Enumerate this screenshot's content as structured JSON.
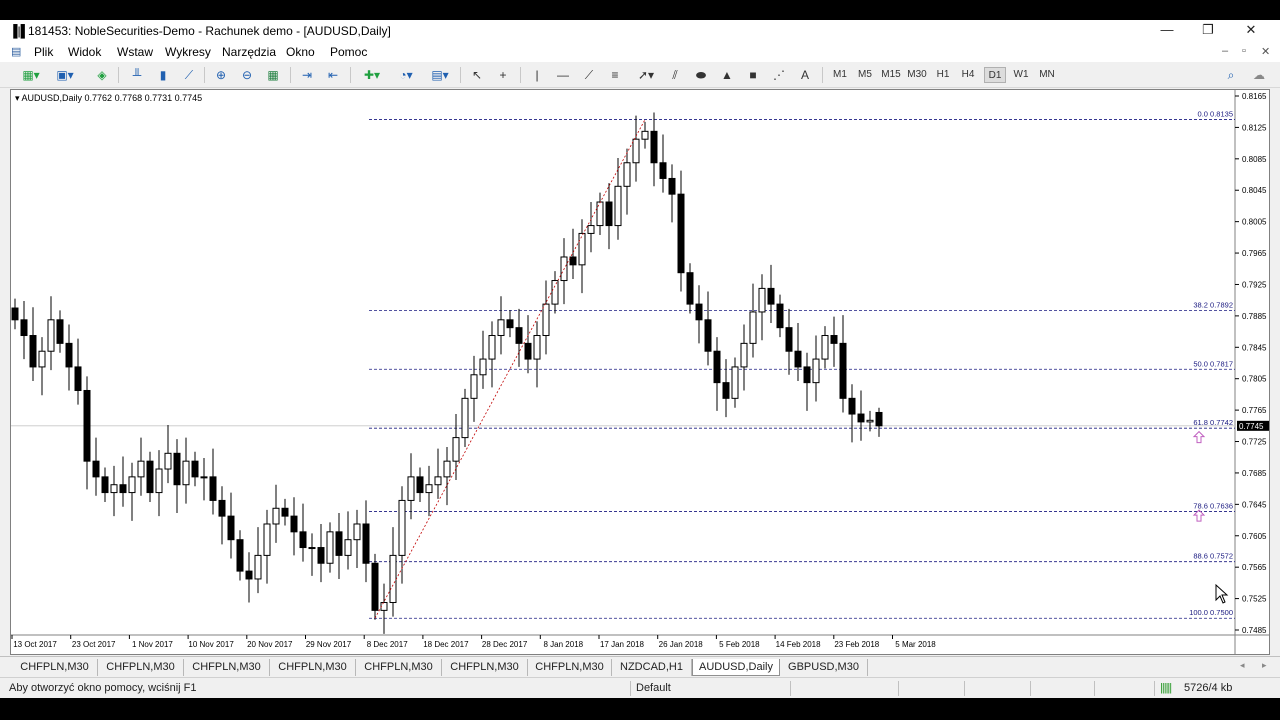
{
  "window": {
    "title": "181453: NobleSecurities-Demo - Rachunek demo - [AUDUSD,Daily]",
    "controls": {
      "minimize": "—",
      "restore": "❐",
      "close": "✕"
    }
  },
  "menu": {
    "items": [
      "Plik",
      "Widok",
      "Wstaw",
      "Wykresy",
      "Narzędzia",
      "Okno",
      "Pomoc"
    ],
    "mdi_controls": {
      "minimize": "–",
      "restore": "▫",
      "close": "✕"
    }
  },
  "toolbar": {
    "timeframes": [
      "M1",
      "M5",
      "M15",
      "M30",
      "H1",
      "H4",
      "D1",
      "W1",
      "MN"
    ],
    "active_timeframe": "D1",
    "draw_text_label": "A"
  },
  "chart": {
    "symbol_info": "AUDUSD,Daily  0.7762 0.7768 0.7731 0.7745",
    "current_price_label": "0.7745",
    "chart_data": {
      "type": "candlestick",
      "title": "AUDUSD,Daily",
      "ohlc_last": {
        "open": 0.7762,
        "high": 0.7768,
        "low": 0.7731,
        "close": 0.7745
      },
      "y_ticks": [
        "0.8165",
        "0.8125",
        "0.8085",
        "0.8045",
        "0.8005",
        "0.7965",
        "0.7925",
        "0.7885",
        "0.7845",
        "0.7805",
        "0.7765",
        "0.7725",
        "0.7685",
        "0.7645",
        "0.7605",
        "0.7565",
        "0.7525",
        "0.7485"
      ],
      "ylim": [
        0.7485,
        0.8165
      ],
      "x_ticks": [
        "13 Oct 2017",
        "23 Oct 2017",
        "1 Nov 2017",
        "10 Nov 2017",
        "20 Nov 2017",
        "29 Nov 2017",
        "8 Dec 2017",
        "18 Dec 2017",
        "28 Dec 2017",
        "8 Jan 2018",
        "17 Jan 2018",
        "26 Jan 2018",
        "5 Feb 2018",
        "14 Feb 2018",
        "23 Feb 2018",
        "5 Mar 2018"
      ],
      "fibonacci": [
        {
          "label": "0.0  0.8135",
          "price": 0.8135
        },
        {
          "label": "38.2  0.7892",
          "price": 0.7892
        },
        {
          "label": "50.0  0.7817",
          "price": 0.7817
        },
        {
          "label": "61.8  0.7742",
          "price": 0.7742
        },
        {
          "label": "78.6  0.7636",
          "price": 0.7636
        },
        {
          "label": "88.6  0.7572",
          "price": 0.7572
        },
        {
          "label": "100.0  0.7500",
          "price": 0.75
        }
      ],
      "closes": [
        0.788,
        0.786,
        0.782,
        0.784,
        0.788,
        0.785,
        0.782,
        0.779,
        0.77,
        0.768,
        0.766,
        0.767,
        0.766,
        0.768,
        0.77,
        0.766,
        0.769,
        0.771,
        0.767,
        0.77,
        0.768,
        0.768,
        0.765,
        0.763,
        0.76,
        0.756,
        0.755,
        0.758,
        0.762,
        0.764,
        0.763,
        0.761,
        0.759,
        0.759,
        0.757,
        0.761,
        0.758,
        0.76,
        0.762,
        0.757,
        0.751,
        0.752,
        0.758,
        0.765,
        0.768,
        0.766,
        0.767,
        0.768,
        0.77,
        0.773,
        0.778,
        0.781,
        0.783,
        0.786,
        0.788,
        0.787,
        0.785,
        0.783,
        0.786,
        0.79,
        0.793,
        0.796,
        0.795,
        0.799,
        0.8,
        0.803,
        0.8,
        0.805,
        0.808,
        0.811,
        0.812,
        0.808,
        0.806,
        0.804,
        0.794,
        0.79,
        0.788,
        0.784,
        0.78,
        0.778,
        0.782,
        0.785,
        0.789,
        0.792,
        0.79,
        0.787,
        0.784,
        0.782,
        0.78,
        0.783,
        0.786,
        0.785,
        0.778,
        0.776,
        0.775,
        0.7752,
        0.7745
      ],
      "annotation_arrows": [
        "buy-arrow",
        "buy-arrow"
      ]
    }
  },
  "tabs": {
    "items": [
      "CHFPLN,M30",
      "CHFPLN,M30",
      "CHFPLN,M30",
      "CHFPLN,M30",
      "CHFPLN,M30",
      "CHFPLN,M30",
      "CHFPLN,M30",
      "NZDCAD,H1",
      "AUDUSD,Daily",
      "GBPUSD,M30"
    ],
    "active": "AUDUSD,Daily"
  },
  "status": {
    "help": "Aby otworzyć okno pomocy, wciśnij F1",
    "profile": "Default",
    "traffic": "5726/4 kb"
  },
  "colors": {
    "candle_body_bull": "#ffffff",
    "candle_body_bear": "#000000",
    "fib_line": "#1a1a80",
    "trend_line": "#c00000",
    "arrow": "#c060c0"
  }
}
